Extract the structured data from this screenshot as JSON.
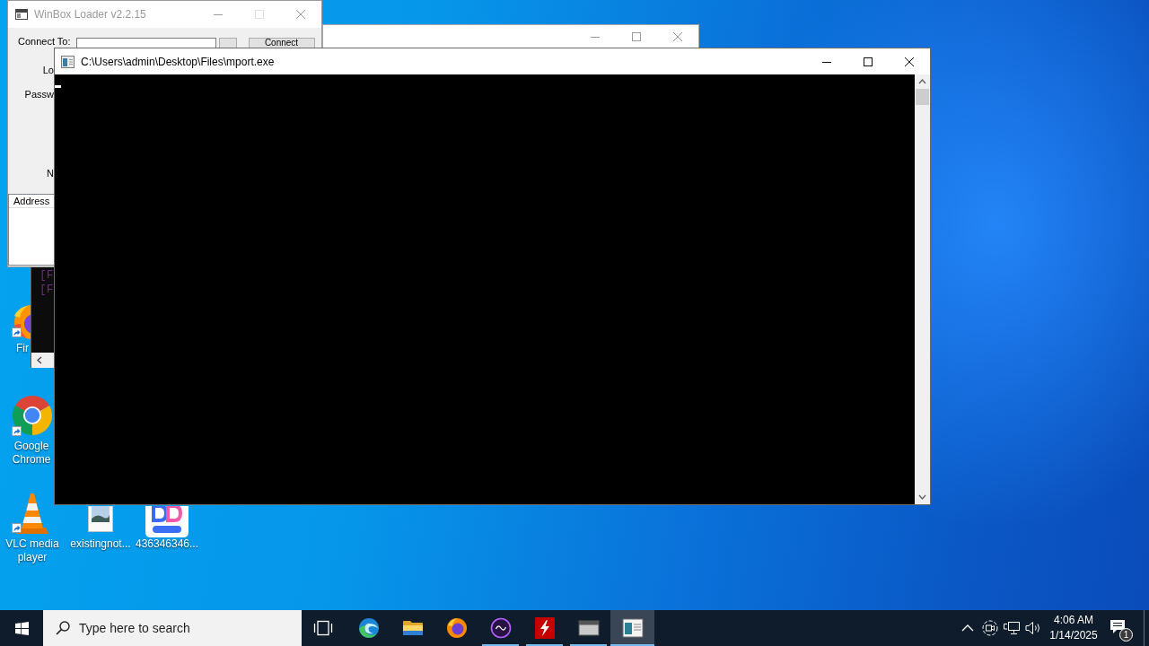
{
  "winbox_window": {
    "title": "WinBox Loader v2.2.15",
    "active": false,
    "maximize_disabled": true,
    "connect_label": "Connect To:",
    "connect_button": "Connect",
    "field_labels": [
      "Lo",
      "Passw",
      "N"
    ],
    "list_columns": [
      "Address"
    ]
  },
  "background_console": {
    "lines": [
      "[F",
      "[F"
    ]
  },
  "console_window": {
    "title": "C:\\Users\\admin\\Desktop\\Files\\mport.exe",
    "active": true
  },
  "desktop": {
    "icons": [
      {
        "label": "Fir",
        "kind": "firefox",
        "shortcut": true
      },
      {
        "label": "Google Chrome",
        "kind": "chrome",
        "shortcut": true
      },
      {
        "label": "VLC media player",
        "kind": "vlc",
        "shortcut": true
      },
      {
        "label": "existingnot...",
        "kind": "image",
        "shortcut": false
      },
      {
        "label": "436346346...",
        "kind": "app",
        "shortcut": false
      }
    ]
  },
  "taskbar": {
    "search": {
      "placeholder": "Type here to search"
    },
    "apps": [
      {
        "kind": "taskview",
        "running": false,
        "selected": false
      },
      {
        "kind": "edge",
        "running": false,
        "selected": false
      },
      {
        "kind": "folder",
        "running": false,
        "selected": false
      },
      {
        "kind": "firefox",
        "running": false,
        "selected": false
      },
      {
        "kind": "ringapp",
        "running": true,
        "selected": false
      },
      {
        "kind": "filezilla",
        "running": true,
        "selected": false
      },
      {
        "kind": "terminal",
        "running": true,
        "selected": false
      },
      {
        "kind": "console",
        "running": true,
        "selected": true
      }
    ],
    "tray": {
      "time": "4:06 AM",
      "date": "1/14/2025",
      "notification_count": "1"
    }
  }
}
